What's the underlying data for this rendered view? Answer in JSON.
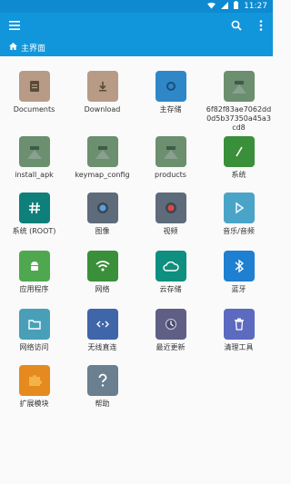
{
  "status": {
    "time": "11:27"
  },
  "appbar": {
    "menu_icon": "menu-icon",
    "search_icon": "search-icon",
    "more_icon": "more-vert-icon"
  },
  "breadcrumb": {
    "label": "主界面",
    "icon": "home-icon"
  },
  "items": [
    {
      "label": "Documents",
      "icon": "folder-doc-icon",
      "color": "#b79b86"
    },
    {
      "label": "Download",
      "icon": "folder-download-icon",
      "color": "#b79b86"
    },
    {
      "label": "主存储",
      "icon": "storage-icon",
      "color": "#2f87c8"
    },
    {
      "label": "6f82f83ae7062dd0d5b37350a45a3cd8",
      "icon": "folder-image-icon",
      "color": "#6b8f6f"
    },
    {
      "label": "install_apk",
      "icon": "folder-image-icon",
      "color": "#6b8f6f"
    },
    {
      "label": "keymap_config",
      "icon": "folder-image-icon",
      "color": "#6b8f6f"
    },
    {
      "label": "products",
      "icon": "folder-image-icon",
      "color": "#6b8f6f"
    },
    {
      "label": "系统",
      "icon": "system-icon",
      "color": "#3a8f3a"
    },
    {
      "label": "系统 (ROOT)",
      "icon": "hash-icon",
      "color": "#0f7f7a"
    },
    {
      "label": "图像",
      "icon": "camera-icon",
      "color": "#5e6b7a"
    },
    {
      "label": "视频",
      "icon": "record-icon",
      "color": "#5e6b7a"
    },
    {
      "label": "音乐/音频",
      "icon": "play-icon",
      "color": "#4aa4c8"
    },
    {
      "label": "应用程序",
      "icon": "android-icon",
      "color": "#4fa84f"
    },
    {
      "label": "网络",
      "icon": "wifi-icon",
      "color": "#3a8f3a"
    },
    {
      "label": "云存储",
      "icon": "cloud-icon",
      "color": "#0f8f7f"
    },
    {
      "label": "蓝牙",
      "icon": "bluetooth-icon",
      "color": "#1f7fd0"
    },
    {
      "label": "网络访问",
      "icon": "folder-network-icon",
      "color": "#4a9fb8"
    },
    {
      "label": "无线直连",
      "icon": "wireless-transfer-icon",
      "color": "#3f66a8"
    },
    {
      "label": "最近更新",
      "icon": "clock-icon",
      "color": "#5f5f86"
    },
    {
      "label": "清理工具",
      "icon": "trash-icon",
      "color": "#5c6ac0"
    },
    {
      "label": "扩展模块",
      "icon": "puzzle-icon",
      "color": "#e58a1f"
    },
    {
      "label": "帮助",
      "icon": "help-icon",
      "color": "#6a7f8f"
    }
  ]
}
